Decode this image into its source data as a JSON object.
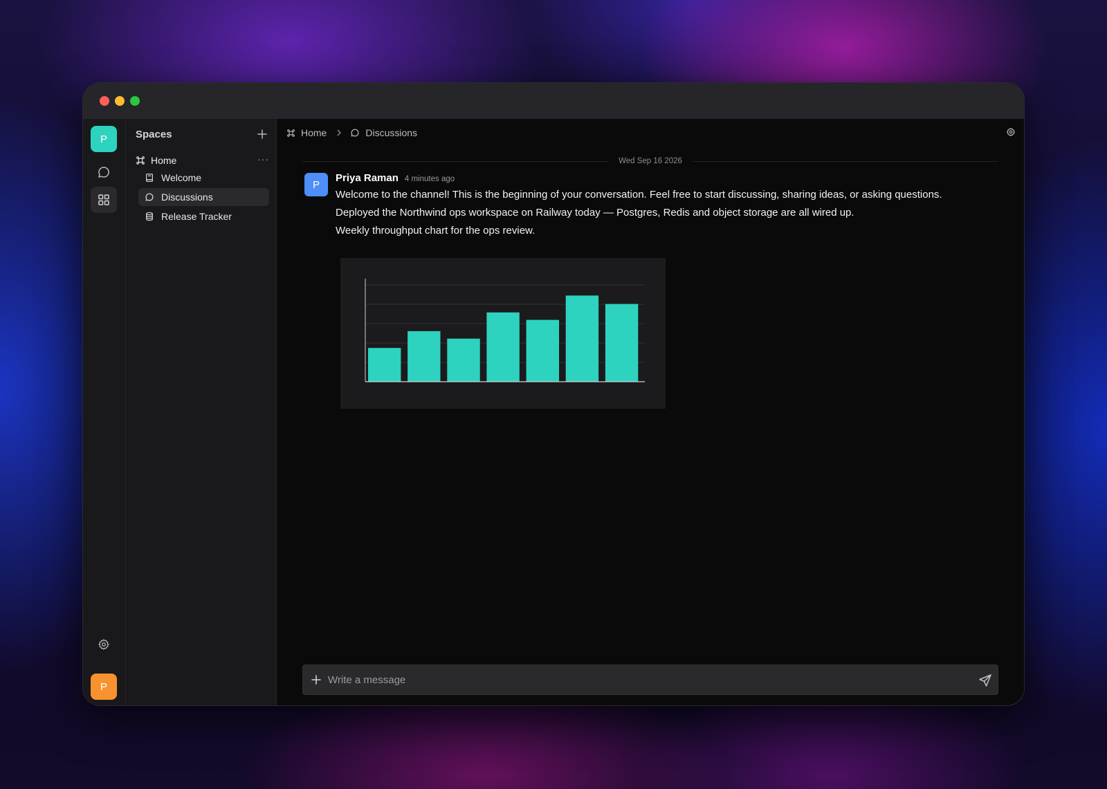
{
  "window": {
    "traffic_lights": [
      "close",
      "minimize",
      "zoom"
    ]
  },
  "rail": {
    "workspace_avatar": "P",
    "user_avatar": "P",
    "icons": [
      "chat-bubble-icon",
      "grid-icon",
      "gear-icon"
    ],
    "colors": {
      "workspace": "#2ed3bf",
      "user": "#f7932e"
    }
  },
  "sidebar": {
    "title": "Spaces",
    "home_label": "Home",
    "items": [
      {
        "label": "Welcome",
        "icon": "book-icon"
      },
      {
        "label": "Discussions",
        "icon": "chat-bubble-icon",
        "active": true
      },
      {
        "label": "Release Tracker",
        "icon": "database-icon"
      }
    ]
  },
  "header": {
    "breadcrumb": [
      "Home",
      "Discussions"
    ]
  },
  "conversation": {
    "date": "Wed Sep 16 2026",
    "message": {
      "avatar": "P",
      "author": "Priya Raman",
      "time": "4 minutes ago",
      "lines": [
        "Welcome to the channel! This is the beginning of your conversation. Feel free to start discussing, sharing ideas, or asking questions.",
        "Deployed the Northwind ops workspace on Railway today — Postgres, Redis and object storage are all wired up.",
        "Weekly throughput chart for the ops review."
      ]
    }
  },
  "chart_data": {
    "type": "bar",
    "values": [
      18,
      27,
      23,
      37,
      33,
      46,
      41.5
    ],
    "ylim": [
      0,
      55
    ],
    "grid": true,
    "bar_color": "#2ed3bf",
    "title": "",
    "xlabel": "",
    "ylabel": ""
  },
  "composer": {
    "placeholder": "Write a message"
  }
}
